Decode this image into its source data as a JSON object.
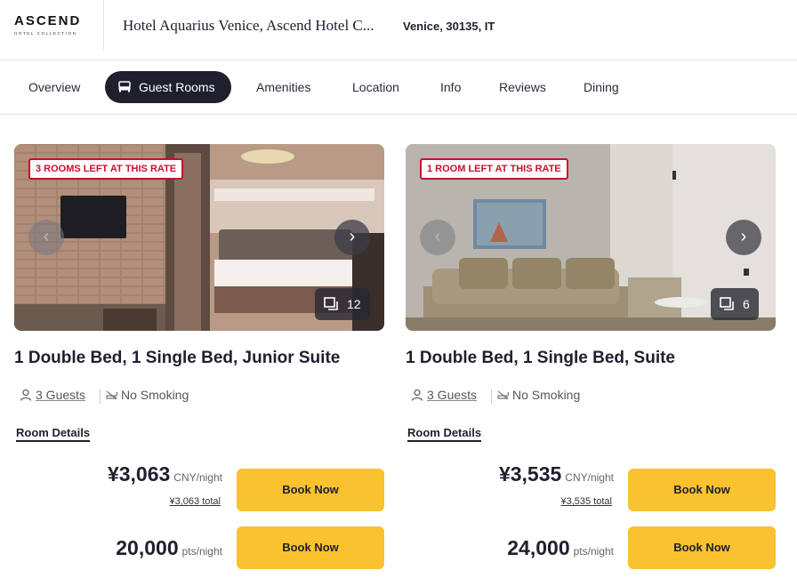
{
  "header": {
    "logo_word": "ASCEND",
    "logo_sub": "HOTEL COLLECTION",
    "hotel_name": "Hotel Aquarius Venice, Ascend Hotel C...",
    "location": "Venice, 30135, IT"
  },
  "tabs": [
    {
      "label": "Overview"
    },
    {
      "label": "Guest Rooms",
      "active": true,
      "icon": "bed-icon"
    },
    {
      "label": "Amenities"
    },
    {
      "label": "Location"
    },
    {
      "label": "Info"
    },
    {
      "label": "Reviews"
    },
    {
      "label": "Dining"
    }
  ],
  "rooms": [
    {
      "availability": "3 ROOMS LEFT AT THIS RATE",
      "photo_count": "12",
      "title": "1 Double Bed, 1 Single Bed, Junior Suite",
      "guests": "3 Guests",
      "smoking": "No Smoking",
      "details_label": "Room Details",
      "price": "¥3,063",
      "price_unit": "CNY/night",
      "price_total": "¥3,063 total",
      "points": "20,000",
      "points_unit": "pts/night",
      "book_label": "Book Now"
    },
    {
      "availability": "1 ROOM LEFT AT THIS RATE",
      "photo_count": "6",
      "title": "1 Double Bed, 1 Single Bed, Suite",
      "guests": "3 Guests",
      "smoking": "No Smoking",
      "details_label": "Room Details",
      "price": "¥3,535",
      "price_unit": "CNY/night",
      "price_total": "¥3,535 total",
      "points": "24,000",
      "points_unit": "pts/night",
      "book_label": "Book Now"
    }
  ],
  "colors": {
    "accent": "#f9c22e",
    "dark": "#1f1f2e",
    "badge_red": "#c8102e"
  }
}
